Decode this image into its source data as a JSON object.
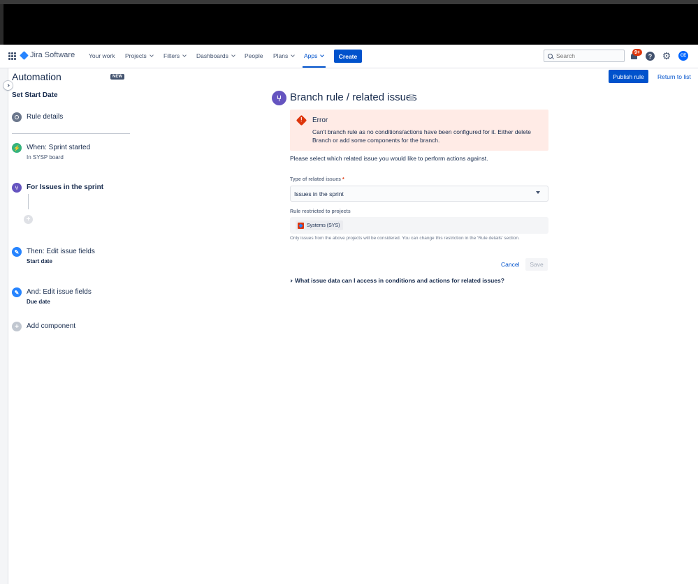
{
  "nav": {
    "product_name": "Jira Software",
    "items": [
      {
        "label": "Your work"
      },
      {
        "label": "Projects"
      },
      {
        "label": "Filters"
      },
      {
        "label": "Dashboards"
      },
      {
        "label": "People"
      },
      {
        "label": "Plans"
      },
      {
        "label": "Apps"
      }
    ],
    "active_item": "Apps",
    "create_label": "Create",
    "search_placeholder": "Search",
    "notification_count": "9+",
    "avatar_initials": "CE"
  },
  "left_panel": {
    "title": "Automation",
    "new_badge": "NEW",
    "rule_name": "Set Start Date",
    "rule_details_label": "Rule details",
    "steps": {
      "trigger": {
        "title": "When: Sprint started",
        "subtitle": "In SYSP board"
      },
      "branch": {
        "title": "For Issues in the sprint"
      },
      "action1": {
        "title": "Then: Edit issue fields",
        "subtitle": "Start date"
      },
      "action2": {
        "title": "And: Edit issue fields",
        "subtitle": "Due date"
      }
    },
    "add_component_label": "Add component"
  },
  "header_actions": {
    "publish_label": "Publish rule",
    "return_label": "Return to list"
  },
  "main": {
    "title": "Branch rule / related issues",
    "error": {
      "title": "Error",
      "message": "Can't branch rule as no conditions/actions have been configured for it. Either delete Branch or add some components for the branch."
    },
    "prompt": "Please select which related issue you would like to perform actions against.",
    "type_label": "Type of related issues",
    "type_required_mark": "*",
    "type_value": "Issues in the sprint",
    "projects_label": "Rule restricted to projects",
    "project_tag": "Systems (SYS)",
    "help_text": "Only issues from the above projects will be considered. You can change this restriction in the 'Rule details' section.",
    "cancel_label": "Cancel",
    "save_label": "Save",
    "faq_label": "What issue data can I access in conditions and actions for related issues?"
  },
  "colors": {
    "brand_blue": "#0052cc",
    "trigger_green": "#36b37e",
    "branch_purple": "#6554c0",
    "action_blue": "#2684ff",
    "error_red": "#de350b",
    "error_bg": "#ffebe6"
  }
}
